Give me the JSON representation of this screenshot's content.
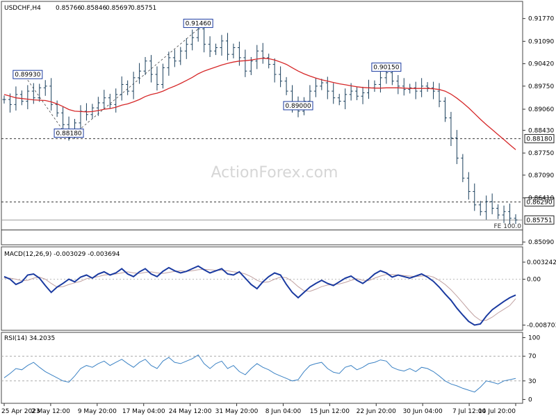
{
  "chart_data": [
    {
      "type": "ohlc",
      "title": "USDCHF,H4",
      "ohlc_header": [
        "0.85766",
        "0.85846",
        "0.85697",
        "0.85751"
      ],
      "watermark": "ActionForex.com",
      "ylim": [
        0.8505,
        0.9195
      ],
      "y_ticks": [
        "0.91770",
        "0.91090",
        "0.90420",
        "0.89750",
        "0.89060",
        "0.88430",
        "0.87750",
        "0.87090",
        "0.86410",
        "0.85090"
      ],
      "x_tick_labels": [
        "25 Apr 2023",
        "2 May 12:00",
        "9 May 20:00",
        "17 May 04:00",
        "24 May 12:00",
        "31 May 20:00",
        "8 Jun 04:00",
        "15 Jun 12:00",
        "22 Jun 20:00",
        "30 Jun 04:00",
        "7 Jul 12:00",
        "14 Jul 20:00"
      ],
      "series_close": [
        0.8935,
        0.892,
        0.895,
        0.893,
        0.896,
        0.894,
        0.897,
        0.8975,
        0.892,
        0.8895,
        0.886,
        0.883,
        0.8865,
        0.89,
        0.889,
        0.891,
        0.8925,
        0.894,
        0.892,
        0.895,
        0.898,
        0.896,
        0.9,
        0.902,
        0.905,
        0.901,
        0.898,
        0.903,
        0.906,
        0.905,
        0.908,
        0.91,
        0.912,
        0.9146,
        0.91,
        0.908,
        0.909,
        0.911,
        0.907,
        0.909,
        0.906,
        0.902,
        0.905,
        0.908,
        0.906,
        0.904,
        0.901,
        0.899,
        0.896,
        0.892,
        0.89,
        0.893,
        0.896,
        0.8975,
        0.8985,
        0.896,
        0.894,
        0.893,
        0.895,
        0.896,
        0.8945,
        0.8955,
        0.897,
        0.898,
        0.9,
        0.9015,
        0.899,
        0.8975,
        0.8965,
        0.897,
        0.896,
        0.8975,
        0.897,
        0.896,
        0.893,
        0.888,
        0.882,
        0.876,
        0.87,
        0.866,
        0.862,
        0.86,
        0.863,
        0.861,
        0.859,
        0.86,
        0.858,
        0.8575
      ],
      "ma_values": [
        0.895,
        0.8945,
        0.894,
        0.8938,
        0.8936,
        0.8934,
        0.8933,
        0.8932,
        0.8928,
        0.8922,
        0.8914,
        0.8905,
        0.89,
        0.8899,
        0.8898,
        0.8899,
        0.8902,
        0.8906,
        0.8908,
        0.8912,
        0.8918,
        0.8922,
        0.8928,
        0.8935,
        0.8944,
        0.895,
        0.8954,
        0.896,
        0.8968,
        0.8975,
        0.8983,
        0.8992,
        0.9001,
        0.9012,
        0.902,
        0.9026,
        0.9032,
        0.9038,
        0.9043,
        0.9047,
        0.905,
        0.9051,
        0.9053,
        0.9056,
        0.9058,
        0.9057,
        0.9053,
        0.9047,
        0.904,
        0.903,
        0.902,
        0.9012,
        0.9005,
        0.8999,
        0.8994,
        0.899,
        0.8986,
        0.8982,
        0.8979,
        0.8976,
        0.8973,
        0.8971,
        0.897,
        0.8969,
        0.8969,
        0.897,
        0.897,
        0.897,
        0.8969,
        0.8968,
        0.8968,
        0.8968,
        0.8968,
        0.8967,
        0.8965,
        0.896,
        0.8951,
        0.8939,
        0.8925,
        0.891,
        0.8893,
        0.8876,
        0.886,
        0.8845,
        0.883,
        0.8815,
        0.88,
        0.8785
      ],
      "annotations": [
        {
          "label": "0.89930",
          "value": 0.8993,
          "index": 4
        },
        {
          "label": "0.91460",
          "value": 0.9146,
          "index": 33
        },
        {
          "label": "0.88180",
          "value": 0.8818,
          "index": 11
        },
        {
          "label": "0.89000",
          "value": 0.89,
          "index": 50
        },
        {
          "label": "0.90150",
          "value": 0.9015,
          "index": 65
        }
      ],
      "hlines": [
        {
          "value": 0.8818,
          "label": "0.88180",
          "style": "dashed"
        },
        {
          "value": 0.8629,
          "label": "0.86290",
          "style": "dashed"
        },
        {
          "value": 0.8575,
          "label": "0.85751",
          "style": "solid-gray"
        },
        {
          "value": 0.8545,
          "label": "FE 100.0",
          "style": "solid-dark"
        }
      ],
      "colors": {
        "bars": "#1a3f5c",
        "ma": "#d62728"
      }
    },
    {
      "type": "line",
      "title": "MACD(12,26,9) -0.003029 -0.003694",
      "y_ticks": [
        "0.003242",
        "0.00",
        "-0.008703"
      ],
      "ylim": [
        -0.0093,
        0.0039
      ],
      "macd": [
        0.0005,
        0.0,
        -0.001,
        -0.0005,
        0.0008,
        0.001,
        0.0002,
        -0.0012,
        -0.0025,
        -0.0015,
        -0.0008,
        0.0,
        -0.0005,
        0.0004,
        0.0008,
        0.0002,
        0.001,
        0.0014,
        0.0008,
        0.0012,
        0.002,
        0.001,
        0.0005,
        0.0014,
        0.002,
        0.001,
        0.0005,
        0.0015,
        0.0022,
        0.0016,
        0.0012,
        0.0015,
        0.002,
        0.0025,
        0.0018,
        0.0012,
        0.0016,
        0.002,
        0.001,
        0.0008,
        0.0014,
        0.0002,
        -0.001,
        -0.0018,
        -0.0005,
        0.0005,
        0.0012,
        0.0008,
        -0.001,
        -0.0025,
        -0.0035,
        -0.0025,
        -0.0015,
        -0.0008,
        -0.0002,
        -0.0008,
        -0.0012,
        -0.0005,
        0.0002,
        0.0006,
        -0.0002,
        -0.0008,
        0.0,
        0.001,
        0.0016,
        0.0012,
        0.0004,
        0.0008,
        0.0005,
        0.0002,
        0.0006,
        0.001,
        0.0004,
        -0.0004,
        -0.0015,
        -0.0028,
        -0.004,
        -0.0055,
        -0.0068,
        -0.008,
        -0.0087,
        -0.0085,
        -0.007,
        -0.0058,
        -0.005,
        -0.0042,
        -0.0035,
        -0.003
      ],
      "signal": [
        0.0002,
        0.0002,
        0.0,
        -0.0003,
        -0.0002,
        0.0002,
        0.0004,
        0.0,
        -0.0008,
        -0.0015,
        -0.0014,
        -0.001,
        -0.0007,
        -0.0004,
        0.0001,
        0.0003,
        0.0005,
        0.0008,
        0.0009,
        0.001,
        0.0012,
        0.0014,
        0.0012,
        0.0011,
        0.0013,
        0.0014,
        0.0012,
        0.0011,
        0.0013,
        0.0015,
        0.0016,
        0.0015,
        0.0016,
        0.0018,
        0.0019,
        0.0018,
        0.0017,
        0.0017,
        0.0016,
        0.0014,
        0.0013,
        0.001,
        0.0005,
        -0.0002,
        -0.0006,
        -0.0005,
        0.0,
        0.0004,
        0.0003,
        -0.0004,
        -0.0014,
        -0.0022,
        -0.0023,
        -0.0019,
        -0.0014,
        -0.0011,
        -0.001,
        -0.0009,
        -0.0006,
        -0.0002,
        0.0001,
        -0.0002,
        -0.0003,
        0.0002,
        0.0006,
        0.0009,
        0.0009,
        0.0008,
        0.0007,
        0.0006,
        0.0005,
        0.0006,
        0.0007,
        0.0004,
        -0.0002,
        -0.001,
        -0.002,
        -0.0032,
        -0.0045,
        -0.0058,
        -0.007,
        -0.0078,
        -0.0078,
        -0.0072,
        -0.0064,
        -0.0057,
        -0.005,
        -0.0037
      ],
      "colors": {
        "macd": "#1a3aa0",
        "signal": "#c0a0a0"
      }
    },
    {
      "type": "line",
      "title": "RSI(14) 34.2035",
      "y_ticks": [
        "100",
        "70",
        "30",
        "0"
      ],
      "ylim": [
        -4,
        104
      ],
      "levels": [
        70,
        30
      ],
      "rsi": [
        35,
        42,
        50,
        48,
        55,
        60,
        52,
        45,
        40,
        35,
        30,
        28,
        38,
        50,
        55,
        52,
        58,
        62,
        55,
        60,
        65,
        58,
        52,
        60,
        65,
        55,
        50,
        62,
        68,
        60,
        58,
        62,
        66,
        72,
        58,
        50,
        58,
        62,
        50,
        55,
        45,
        40,
        50,
        58,
        52,
        48,
        42,
        38,
        34,
        30,
        32,
        45,
        55,
        58,
        60,
        50,
        44,
        42,
        52,
        55,
        48,
        52,
        58,
        60,
        64,
        62,
        52,
        48,
        46,
        50,
        45,
        52,
        50,
        45,
        38,
        30,
        25,
        22,
        18,
        15,
        12,
        20,
        30,
        28,
        25,
        30,
        32,
        34
      ],
      "colors": {
        "rsi": "#3b82c4"
      }
    }
  ]
}
